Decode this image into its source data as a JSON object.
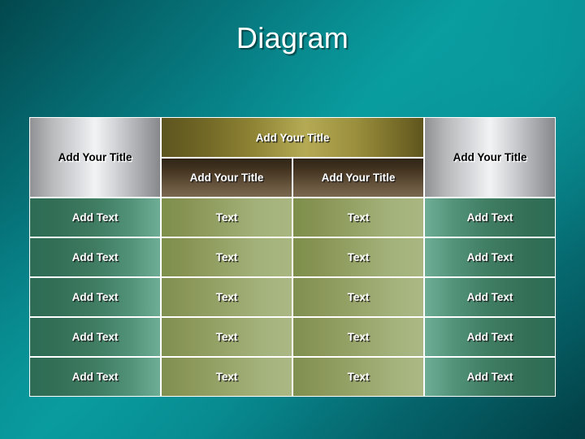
{
  "slide": {
    "title": "Diagram",
    "background_color_dark": "#02484d",
    "background_color_light": "#0a9a9c"
  },
  "table": {
    "header": {
      "left_title": "Add Your Title",
      "merged_title": "Add Your Title",
      "right_title": "Add Your Title",
      "sub_titles": [
        "Add Your Title",
        "Add Your Title"
      ]
    },
    "rows": [
      {
        "c1": "Add Text",
        "c2": "Text",
        "c3": "Text",
        "c4": "Add Text"
      },
      {
        "c1": "Add Text",
        "c2": "Text",
        "c3": "Text",
        "c4": "Add Text"
      },
      {
        "c1": "Add Text",
        "c2": "Text",
        "c3": "Text",
        "c4": "Add Text"
      },
      {
        "c1": "Add Text",
        "c2": "Text",
        "c3": "Text",
        "c4": "Add Text"
      },
      {
        "c1": "Add Text",
        "c2": "Text",
        "c3": "Text",
        "c4": "Add Text"
      }
    ],
    "colors": {
      "silver_header": "#dcdde0",
      "olive_header": "#b5aa54",
      "brown_subheader": "#483824",
      "teal_body": "#3e7b60",
      "green_body": "#97a469",
      "border": "#ffffff"
    }
  }
}
